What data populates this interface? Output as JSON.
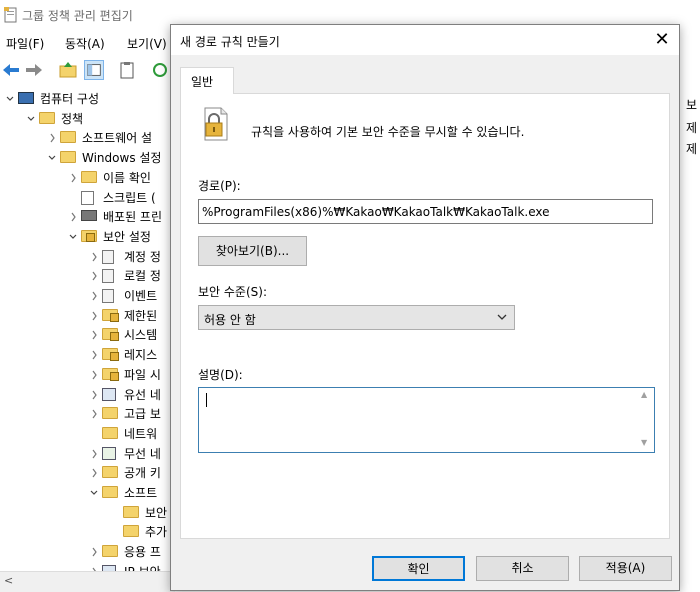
{
  "app": {
    "title": "그룹 정책 관리 편집기",
    "menu": [
      "파일(F)",
      "동작(A)",
      "보기(V)"
    ]
  },
  "tree": [
    {
      "label": "컴퓨터 구성",
      "indent": 0,
      "expander": "v",
      "icon": "computer-icon"
    },
    {
      "label": "정책",
      "indent": 1,
      "expander": "v",
      "icon": "folder-icon"
    },
    {
      "label": "소프트웨어 설",
      "indent": 2,
      "expander": ">",
      "icon": "folder-icon"
    },
    {
      "label": "Windows 설정",
      "indent": 2,
      "expander": "v",
      "icon": "folder-icon"
    },
    {
      "label": "이름 확인",
      "indent": 3,
      "expander": ">",
      "icon": "folder-icon"
    },
    {
      "label": "스크립트 (",
      "indent": 3,
      "expander": "",
      "icon": "script-icon"
    },
    {
      "label": "배포된 프린",
      "indent": 3,
      "expander": ">",
      "icon": "printer-icon"
    },
    {
      "label": "보안 설정",
      "indent": 3,
      "expander": "v",
      "icon": "security-icon"
    },
    {
      "label": "계정 정",
      "indent": 4,
      "expander": ">",
      "icon": "policy-icon"
    },
    {
      "label": "로컬 정",
      "indent": 4,
      "expander": ">",
      "icon": "policy-icon"
    },
    {
      "label": "이벤트",
      "indent": 4,
      "expander": ">",
      "icon": "policy-icon"
    },
    {
      "label": "제한된",
      "indent": 4,
      "expander": ">",
      "icon": "folder-lock-icon"
    },
    {
      "label": "시스템",
      "indent": 4,
      "expander": ">",
      "icon": "folder-lock-icon"
    },
    {
      "label": "레지스",
      "indent": 4,
      "expander": ">",
      "icon": "folder-lock-icon"
    },
    {
      "label": "파일 시",
      "indent": 4,
      "expander": ">",
      "icon": "folder-lock-icon"
    },
    {
      "label": "유선 네",
      "indent": 4,
      "expander": ">",
      "icon": "network-icon"
    },
    {
      "label": "고급 보",
      "indent": 4,
      "expander": ">",
      "icon": "folder-icon"
    },
    {
      "label": "네트워",
      "indent": 4,
      "expander": "",
      "icon": "folder-icon"
    },
    {
      "label": "무선 네",
      "indent": 4,
      "expander": ">",
      "icon": "chart-icon"
    },
    {
      "label": "공개 키",
      "indent": 4,
      "expander": ">",
      "icon": "folder-icon"
    },
    {
      "label": "소프트",
      "indent": 4,
      "expander": "v",
      "icon": "folder-icon"
    },
    {
      "label": "보안",
      "indent": 5,
      "expander": "",
      "icon": "folder-icon"
    },
    {
      "label": "추가",
      "indent": 5,
      "expander": "",
      "icon": "folder-icon",
      "selected": true
    },
    {
      "label": "응용 프",
      "indent": 4,
      "expander": ">",
      "icon": "folder-icon"
    },
    {
      "label": "IP 보안",
      "indent": 4,
      "expander": ">",
      "icon": "network-icon"
    }
  ],
  "right_pane": [
    "보",
    "제",
    "제"
  ],
  "dialog": {
    "title": "새 경로 규칙 만들기",
    "tab_label": "일반",
    "description": "규칙을 사용하여 기본 보안 수준을 무시할 수 있습니다.",
    "path_label": "경로(P):",
    "path_value": "%ProgramFiles(x86)%₩Kakao₩KakaoTalk₩KakaoTalk.exe",
    "browse_label": "찾아보기(B)...",
    "security_label": "보안 수준(S):",
    "security_value": "허용 안 함",
    "description_label": "설명(D):",
    "description_value": "",
    "ok_label": "확인",
    "cancel_label": "취소",
    "apply_label": "적용(A)"
  },
  "colors": {
    "focus_blue": "#0078d7",
    "dialog_bg": "#f0f0f0",
    "folder_yellow": "#f4d36b"
  }
}
